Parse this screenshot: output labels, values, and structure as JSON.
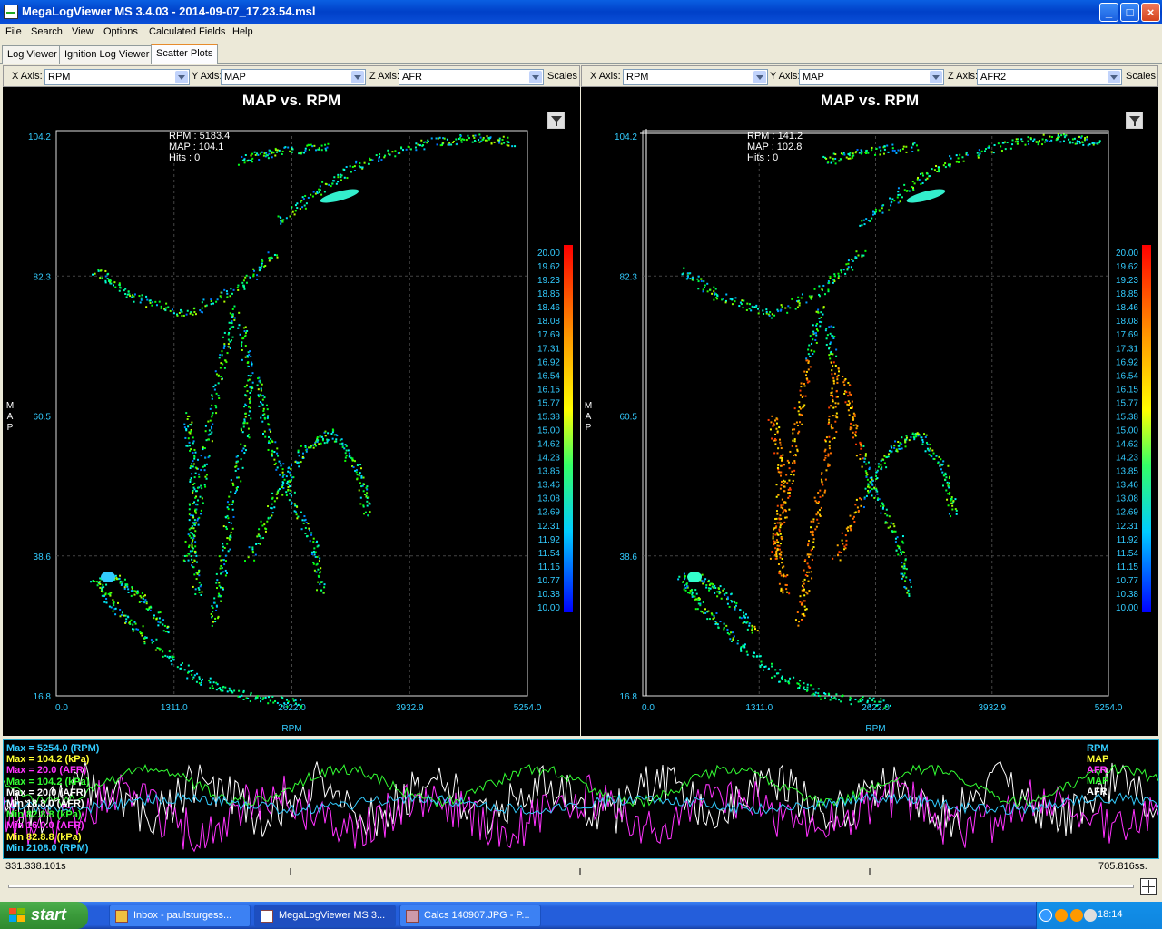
{
  "window": {
    "title": "MegaLogViewer MS 3.4.03 - 2014-09-07_17.23.54.msl"
  },
  "menu": [
    "File",
    "Search",
    "View",
    "Options",
    "Calculated Fields",
    "Help"
  ],
  "tabs": [
    "Log Viewer",
    "Ignition Log Viewer",
    "Scatter Plots"
  ],
  "active_tab": "Scatter Plots",
  "panels": [
    {
      "x_axis_label": "X Axis:",
      "x_axis_value": "RPM",
      "y_axis_label": "Y Axis:",
      "y_axis_value": "MAP",
      "z_axis_label": "Z Axis:",
      "z_axis_value": "AFR",
      "scales_label": "Scales",
      "title": "MAP vs. RPM",
      "cursor_info": [
        "RPM : 5183.4",
        "MAP : 104.1",
        "Hits : 0"
      ],
      "y_ticks": [
        "104.2",
        "82.3",
        "60.5",
        "38.6",
        "16.8"
      ],
      "x_ticks": [
        "0.0",
        "1311.0",
        "2622.0",
        "3932.9",
        "5254.0"
      ],
      "x_label": "RPM",
      "y_label": "MAP"
    },
    {
      "x_axis_label": "X Axis:",
      "x_axis_value": "RPM",
      "y_axis_label": "Y Axis:",
      "y_axis_value": "MAP",
      "z_axis_label": "Z Axis:",
      "z_axis_value": "AFR2",
      "scales_label": "Scales",
      "title": "MAP vs. RPM",
      "cursor_info": [
        "RPM : 141.2",
        "MAP : 102.8",
        "Hits : 0"
      ],
      "y_ticks": [
        "104.2",
        "82.3",
        "60.5",
        "38.6",
        "16.8"
      ],
      "x_ticks": [
        "0.0",
        "1311.0",
        "2622.0",
        "3932.9",
        "5254.0"
      ],
      "x_label": "RPM",
      "y_label": "MAP"
    }
  ],
  "color_scale": [
    "20.00",
    "19.62",
    "19.23",
    "18.85",
    "18.46",
    "18.08",
    "17.69",
    "17.31",
    "16.92",
    "16.54",
    "16.15",
    "15.77",
    "15.38",
    "15.00",
    "14.62",
    "14.23",
    "13.85",
    "13.46",
    "13.08",
    "12.69",
    "12.31",
    "11.92",
    "11.54",
    "11.15",
    "10.77",
    "10.38",
    "10.00"
  ],
  "timechart": {
    "left_legend": [
      {
        "text": "Max = 5254.0 (RPM)",
        "color": "#33ccff"
      },
      {
        "text": "Max = 104.2 (kPa)",
        "color": "#ffff33"
      },
      {
        "text": "Max = 20.0 (AFR)",
        "color": "#ff33ff"
      },
      {
        "text": "Max = 104.2 (kPa)",
        "color": "#33ff33"
      },
      {
        "text": "Max = 20.0 (AFR)",
        "color": "#ffffff"
      },
      {
        "text": "Min 18.8.0 (AFR)",
        "color": "#ffffff"
      },
      {
        "text": "Min 82.8.8 (kPa)",
        "color": "#33ff33"
      },
      {
        "text": "Min 16.0.0 (AFR)",
        "color": "#ff33ff"
      },
      {
        "text": "Min 82.8.8 (kPa)",
        "color": "#ffff33"
      },
      {
        "text": "Min 2108.0 (RPM)",
        "color": "#33ccff"
      }
    ],
    "right_legend": [
      {
        "text": "RPM",
        "color": "#33ccff"
      },
      {
        "text": "MAP",
        "color": "#ffff33"
      },
      {
        "text": "AFR",
        "color": "#ff33ff"
      },
      {
        "text": "MAP",
        "color": "#33ff33"
      },
      {
        "text": "AFR",
        "color": "#ffffff"
      }
    ]
  },
  "status": {
    "left": "331.338.101s",
    "right": "705.816ss."
  },
  "taskbar": {
    "start": "start",
    "items": [
      "Inbox - paulsturgess...",
      "MegaLogViewer MS 3...",
      "Calcs 140907.JPG - P..."
    ],
    "clock": "18:14"
  }
}
